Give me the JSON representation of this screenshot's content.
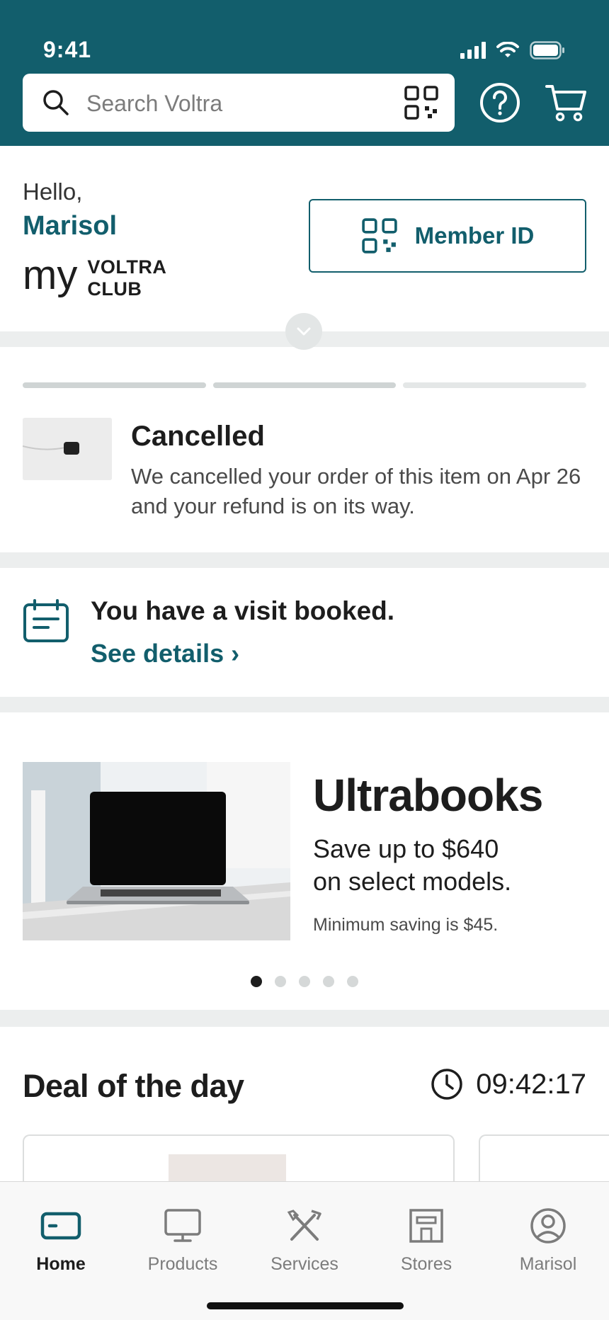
{
  "status_bar": {
    "time": "9:41"
  },
  "search": {
    "placeholder": "Search Voltra"
  },
  "greeting": {
    "hello": "Hello,",
    "name": "Marisol",
    "brand_prefix": "my",
    "brand_line1": "VOLTRA",
    "brand_line2": "CLUB",
    "member_button": "Member ID"
  },
  "order": {
    "progress_segments": 3,
    "status": "Cancelled",
    "message": "We cancelled your order of this item on Apr 26 and your refund is on its way."
  },
  "visit": {
    "title": "You have a visit booked.",
    "link": "See details ›"
  },
  "promo": {
    "title": "Ultrabooks",
    "subtitle_line1": "Save up to $640",
    "subtitle_line2": "on select models.",
    "note": "Minimum saving is $45.",
    "slide_count": 5,
    "active_slide": 1
  },
  "deal": {
    "title": "Deal of the day",
    "timer": "09:42:17"
  },
  "tabs": [
    {
      "label": "Home",
      "icon": "home-icon",
      "active": true
    },
    {
      "label": "Products",
      "icon": "monitor-icon",
      "active": false
    },
    {
      "label": "Services",
      "icon": "tools-icon",
      "active": false
    },
    {
      "label": "Stores",
      "icon": "store-icon",
      "active": false
    },
    {
      "label": "Marisol",
      "icon": "account-icon",
      "active": false
    }
  ],
  "colors": {
    "brand": "#125e6c",
    "text": "#1d1d1d",
    "muted": "#7c7c7c",
    "divider": "#eceeee"
  }
}
